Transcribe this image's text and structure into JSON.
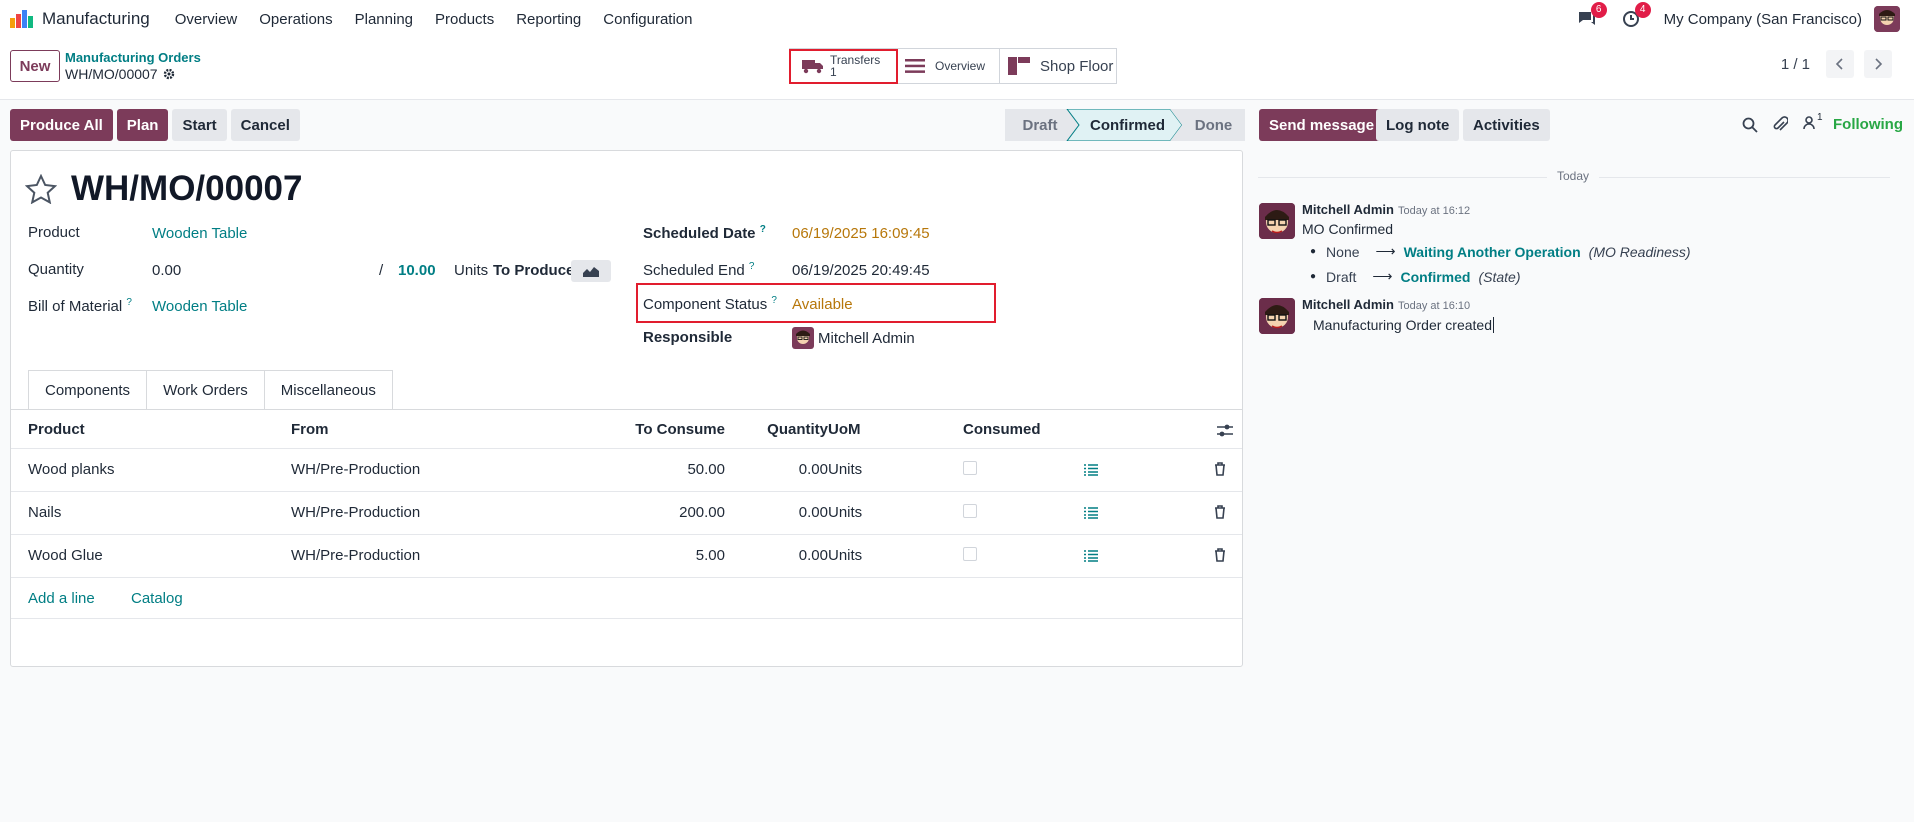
{
  "nav": {
    "app_name": "Manufacturing",
    "menu": [
      "Overview",
      "Operations",
      "Planning",
      "Products",
      "Reporting",
      "Configuration"
    ],
    "messages_badge": "6",
    "activities_badge": "4",
    "company": "My Company (San Francisco)"
  },
  "control_panel": {
    "new_label": "New",
    "breadcrumb_parent": "Manufacturing Orders",
    "breadcrumb_current": "WH/MO/00007",
    "transfers_label": "Transfers",
    "transfers_count": "1",
    "overview_label": "Overview",
    "shop_floor_label": "Shop Floor",
    "pager": "1 / 1"
  },
  "actions": {
    "produce_all": "Produce All",
    "plan": "Plan",
    "start": "Start",
    "cancel": "Cancel"
  },
  "statusbar": {
    "stages": [
      "Draft",
      "Confirmed",
      "Done"
    ],
    "active_stage": "Confirmed"
  },
  "form": {
    "title": "WH/MO/00007",
    "product_label": "Product",
    "product_value": "Wooden Table",
    "quantity_label": "Quantity",
    "quantity_value": "0.00",
    "qty_separator": "/",
    "quantity_target": "10.00",
    "units_label": "Units",
    "to_produce_label": "To Produce",
    "bom_label": "Bill of Material",
    "bom_help": "?",
    "bom_value": "Wooden Table",
    "scheduled_date_label": "Scheduled Date",
    "scheduled_date_help": "?",
    "scheduled_date_value": "06/19/2025 16:09:45",
    "scheduled_end_label": "Scheduled End",
    "scheduled_end_help": "?",
    "scheduled_end_value": "06/19/2025 20:49:45",
    "component_status_label": "Component Status",
    "component_status_help": "?",
    "component_status_value": "Available",
    "responsible_label": "Responsible",
    "responsible_value": "Mitchell Admin"
  },
  "tabs": [
    "Components",
    "Work Orders",
    "Miscellaneous"
  ],
  "components": {
    "headers": [
      "Product",
      "From",
      "To Consume",
      "Quantity",
      "UoM",
      "Consumed"
    ],
    "rows": [
      {
        "product": "Wood planks",
        "from": "WH/Pre-Production",
        "to_consume": "50.00",
        "quantity": "0.00",
        "uom": "Units"
      },
      {
        "product": "Nails",
        "from": "WH/Pre-Production",
        "to_consume": "200.00",
        "quantity": "0.00",
        "uom": "Units"
      },
      {
        "product": "Wood Glue",
        "from": "WH/Pre-Production",
        "to_consume": "5.00",
        "quantity": "0.00",
        "uom": "Units"
      }
    ],
    "add_line": "Add a line",
    "catalog": "Catalog"
  },
  "chatter": {
    "send_message": "Send message",
    "log_note": "Log note",
    "activities": "Activities",
    "followers_count": "1",
    "following": "Following",
    "date_separator": "Today",
    "messages": [
      {
        "author": "Mitchell Admin",
        "time": "Today at 16:12",
        "body": "MO Confirmed",
        "changes": [
          {
            "old": "None",
            "new": "Waiting Another Operation",
            "field": "(MO Readiness)"
          },
          {
            "old": "Draft",
            "new": "Confirmed",
            "field": "(State)"
          }
        ]
      },
      {
        "author": "Mitchell Admin",
        "time": "Today at 16:10",
        "body": "Manufacturing Order created"
      }
    ]
  },
  "colors": {
    "primary": "#7c3b5a",
    "link": "#017e84",
    "warning_text": "#b7770a",
    "following": "#28a745",
    "highlight_box": "#e11d2e"
  }
}
